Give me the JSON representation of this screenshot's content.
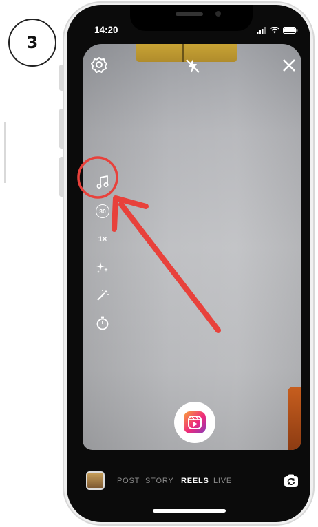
{
  "step": {
    "number": "3"
  },
  "status_bar": {
    "time": "14:20"
  },
  "camera": {
    "top_icons": [
      "settings-icon",
      "flash-off-icon",
      "close-icon"
    ],
    "side_tools": [
      {
        "name": "audio",
        "icon": "music-note-icon"
      },
      {
        "name": "length",
        "icon": "length-timer-icon",
        "label": "30"
      },
      {
        "name": "speed",
        "icon": "speed-icon",
        "label": "1×"
      },
      {
        "name": "effects",
        "icon": "sparkles-icon"
      },
      {
        "name": "touch-up",
        "icon": "magic-wand-icon"
      },
      {
        "name": "timer",
        "icon": "countdown-timer-icon"
      }
    ],
    "record_button": {
      "icon": "reels-icon"
    }
  },
  "mode_bar": {
    "modes": [
      "POST",
      "STORY",
      "REELS",
      "LIVE"
    ],
    "active": "REELS",
    "icons": [
      "gallery-thumbnail",
      "flip-camera-icon"
    ]
  },
  "annotation": {
    "highlight_color": "#e8413b"
  },
  "colors": {
    "screen_bg": "#0b0b0b",
    "accent": "#ee2a7b"
  }
}
